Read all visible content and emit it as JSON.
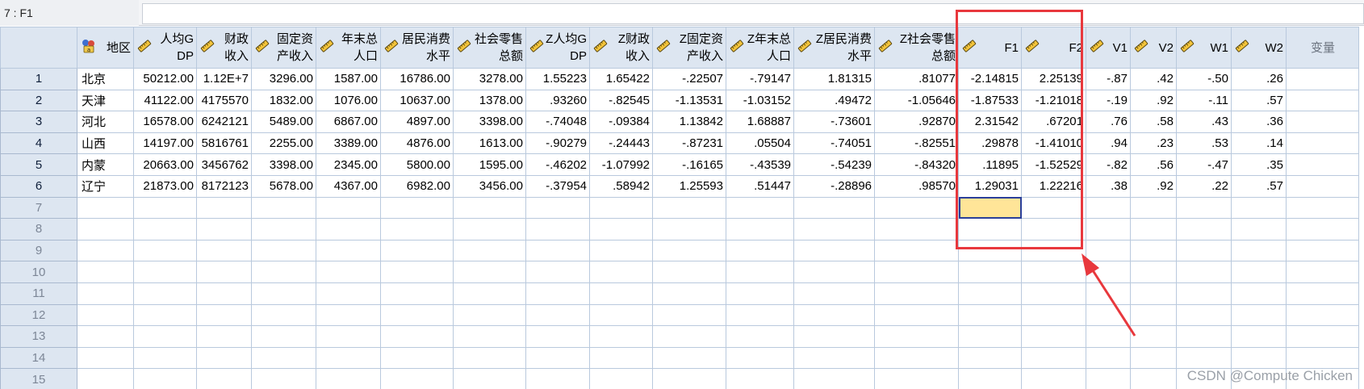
{
  "edit_bar": {
    "cell_ref": "7 : F1",
    "cell_value": ""
  },
  "columns": [
    {
      "label": "地区",
      "icon": "string-nominal-icon"
    },
    {
      "label": "人均GDP",
      "icon": "ruler-icon"
    },
    {
      "label": "财政收入",
      "icon": "ruler-icon"
    },
    {
      "label": "固定资产收入",
      "icon": "ruler-icon"
    },
    {
      "label": "年末总人口",
      "icon": "ruler-icon"
    },
    {
      "label": "居民消费水平",
      "icon": "ruler-icon"
    },
    {
      "label": "社会零售总额",
      "icon": "ruler-icon"
    },
    {
      "label": "Z人均GDP",
      "icon": "ruler-icon"
    },
    {
      "label": "Z财政收入",
      "icon": "ruler-icon"
    },
    {
      "label": "Z固定资产收入",
      "icon": "ruler-icon"
    },
    {
      "label": "Z年末总人口",
      "icon": "ruler-icon"
    },
    {
      "label": "Z居民消费水平",
      "icon": "ruler-icon"
    },
    {
      "label": "Z社会零售总额",
      "icon": "ruler-icon"
    },
    {
      "label": "F1",
      "icon": "ruler-icon"
    },
    {
      "label": "F2",
      "icon": "ruler-icon"
    },
    {
      "label": "V1",
      "icon": "ruler-icon"
    },
    {
      "label": "V2",
      "icon": "ruler-icon"
    },
    {
      "label": "W1",
      "icon": "ruler-icon"
    },
    {
      "label": "W2",
      "icon": "ruler-icon"
    },
    {
      "label": "变量",
      "icon": ""
    }
  ],
  "rows": [
    {
      "num": "1",
      "cells": [
        "北京",
        "50212.00",
        "1.12E+7",
        "3296.00",
        "1587.00",
        "16786.00",
        "3278.00",
        "1.55223",
        "1.65422",
        "-.22507",
        "-.79147",
        "1.81315",
        ".81077",
        "-2.14815",
        "2.25139",
        "-.87",
        ".42",
        "-.50",
        ".26",
        ""
      ]
    },
    {
      "num": "2",
      "cells": [
        "天津",
        "41122.00",
        "4175570",
        "1832.00",
        "1076.00",
        "10637.00",
        "1378.00",
        ".93260",
        "-.82545",
        "-1.13531",
        "-1.03152",
        ".49472",
        "-1.05646",
        "-1.87533",
        "-1.21018",
        "-.19",
        ".92",
        "-.11",
        ".57",
        ""
      ]
    },
    {
      "num": "3",
      "cells": [
        "河北",
        "16578.00",
        "6242121",
        "5489.00",
        "6867.00",
        "4897.00",
        "3398.00",
        "-.74048",
        "-.09384",
        "1.13842",
        "1.68887",
        "-.73601",
        ".92870",
        "2.31542",
        ".67201",
        ".76",
        ".58",
        ".43",
        ".36",
        ""
      ]
    },
    {
      "num": "4",
      "cells": [
        "山西",
        "14197.00",
        "5816761",
        "2255.00",
        "3389.00",
        "4876.00",
        "1613.00",
        "-.90279",
        "-.24443",
        "-.87231",
        ".05504",
        "-.74051",
        "-.82551",
        ".29878",
        "-1.41010",
        ".94",
        ".23",
        ".53",
        ".14",
        ""
      ]
    },
    {
      "num": "5",
      "cells": [
        "内蒙",
        "20663.00",
        "3456762",
        "3398.00",
        "2345.00",
        "5800.00",
        "1595.00",
        "-.46202",
        "-1.07992",
        "-.16165",
        "-.43539",
        "-.54239",
        "-.84320",
        ".11895",
        "-1.52529",
        "-.82",
        ".56",
        "-.47",
        ".35",
        ""
      ]
    },
    {
      "num": "6",
      "cells": [
        "辽宁",
        "21873.00",
        "8172123",
        "5678.00",
        "4367.00",
        "6982.00",
        "3456.00",
        "-.37954",
        ".58942",
        "1.25593",
        ".51447",
        "-.28896",
        ".98570",
        "1.29031",
        "1.22216",
        ".38",
        ".92",
        ".22",
        ".57",
        ""
      ]
    },
    {
      "num": "7",
      "cells": []
    },
    {
      "num": "8",
      "cells": []
    },
    {
      "num": "9",
      "cells": []
    },
    {
      "num": "10",
      "cells": []
    },
    {
      "num": "11",
      "cells": []
    },
    {
      "num": "12",
      "cells": []
    },
    {
      "num": "13",
      "cells": []
    },
    {
      "num": "14",
      "cells": []
    },
    {
      "num": "15",
      "cells": []
    }
  ],
  "selected": {
    "row": "7",
    "column": "F1"
  },
  "annotation": {
    "highlight": "red-box-around-F1-F2",
    "color": "#e8383d"
  },
  "watermark": "CSDN @Compute Chicken"
}
